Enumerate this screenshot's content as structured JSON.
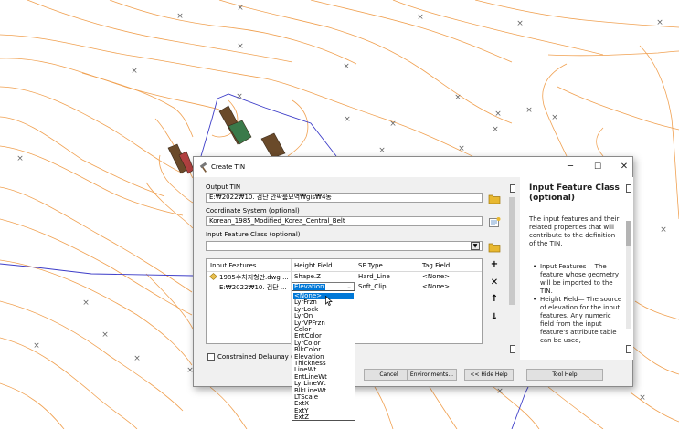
{
  "window": {
    "title": "Create TIN",
    "minimize_glyph": "─",
    "maximize_glyph": "☐",
    "close_glyph": "✕"
  },
  "form": {
    "output_tin": {
      "label": "Output TIN",
      "value": "E:₩2022₩10. 검단 안팍룸묘역₩gis₩4동"
    },
    "coordinate_system": {
      "label": "Coordinate System (optional)",
      "value": "Korean_1985_Modified_Korea_Central_Belt"
    },
    "input_feature_class": {
      "label": "Input Feature Class (optional)",
      "value": ""
    },
    "table": {
      "headers": [
        "Input Features",
        "Height Field",
        "SF Type",
        "Tag Field"
      ],
      "rows": [
        [
          "1985수치지형만.dwg ...",
          "Shape.Z",
          "Hard_Line",
          "<None>"
        ],
        [
          "E:₩2022₩10. 검단 ...",
          "Elevation",
          "Soft_Clip",
          "<None>"
        ]
      ]
    },
    "height_field_options": [
      "<None>",
      "LyrFrzn",
      "LyrLock",
      "LyrOn",
      "LyrVPFrzn",
      "Color",
      "EntColor",
      "LyrColor",
      "BlkColor",
      "Elevation",
      "Thickness",
      "LineWt",
      "EntLineWt",
      "LyrLineWt",
      "BlkLineWt",
      "LTScale",
      "ExtX",
      "ExtY",
      "ExtZ"
    ],
    "selected_height_option": "<None>",
    "constrained_delaunay_label": "Constrained Delaunay (o"
  },
  "buttons": {
    "cancel": "Cancel",
    "environments": "Environments...",
    "hide_help": "<< Hide Help",
    "tool_help": "Tool Help"
  },
  "side_buttons": {
    "add": "+",
    "remove": "✕",
    "up": "↑",
    "down": "↓"
  },
  "help": {
    "title": "Input Feature Class (optional)",
    "body": "The input features and their related properties that will contribute to the definition of the TIN.",
    "bullets": [
      "Input Features— The feature whose geometry will be imported to the TIN.",
      "Height Field— The source of elevation for the input features. Any numeric field from the input feature's attribute table can be used,"
    ]
  },
  "colors": {
    "contour": "#f0a050",
    "boundary": "#3c3cc8",
    "highlight": "#0078d7",
    "building_dark": "#6a4a2a",
    "building_green": "#3a7a4a"
  },
  "map": {
    "marker_glyph": "×"
  }
}
